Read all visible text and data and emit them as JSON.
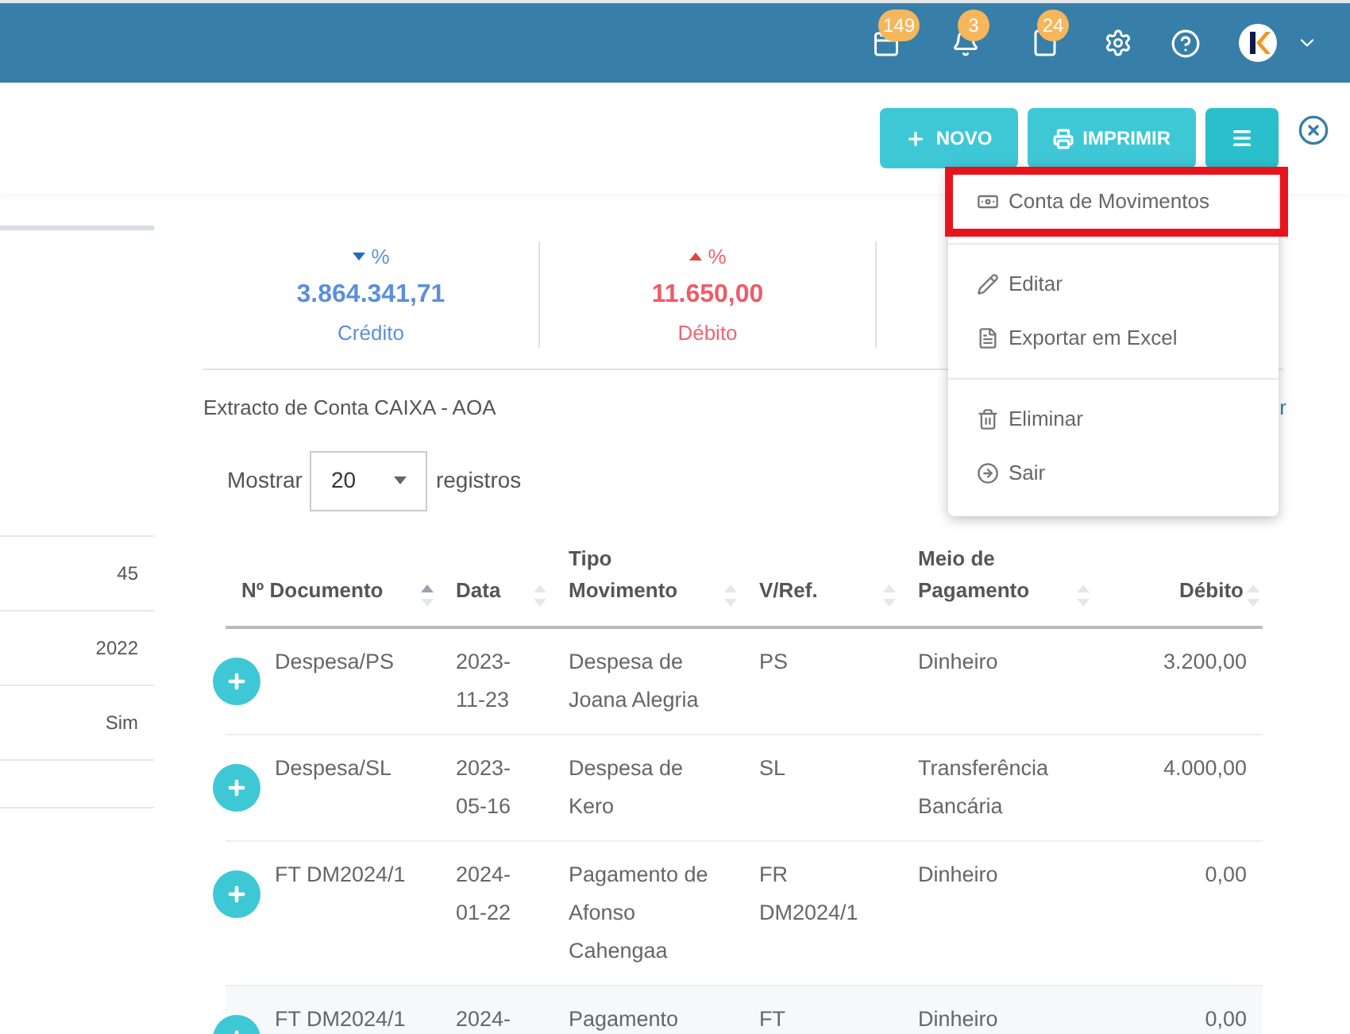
{
  "header": {
    "badges": [
      {
        "kind": "calendar",
        "count": "149"
      },
      {
        "kind": "bell",
        "count": "3"
      },
      {
        "kind": "file",
        "count": "24"
      }
    ]
  },
  "toolbar": {
    "buttons": [
      {
        "kind": "new",
        "label": "NOVO"
      },
      {
        "kind": "print",
        "label": "IMPRIMIR"
      },
      {
        "kind": "menu"
      }
    ]
  },
  "menu": {
    "groups": [
      [
        {
          "kind": "money",
          "label": "Conta de Movimentos",
          "highlighted": true
        }
      ],
      [
        {
          "kind": "pencil",
          "label": "Editar",
          "highlighted": false
        },
        {
          "kind": "file",
          "label": "Exportar em Excel",
          "highlighted": false
        }
      ],
      [
        {
          "kind": "trash",
          "label": "Eliminar",
          "highlighted": false
        },
        {
          "kind": "exit",
          "label": "Sair",
          "highlighted": false
        }
      ]
    ]
  },
  "side_panel": {
    "values": [
      "45",
      "2022",
      "Sim"
    ]
  },
  "stats": [
    {
      "kind": "credit",
      "percent": "%",
      "value": "3.864.341,71",
      "label": "Crédito"
    },
    {
      "kind": "debit",
      "percent": "%",
      "value": "11.650,00",
      "label": "Débito"
    }
  ],
  "statement_title": "Extracto de Conta CAIXA - AOA",
  "side_link": "r",
  "page_size": {
    "before": "Mostrar",
    "value": "20",
    "after": "registros"
  },
  "table": {
    "columns": [
      {
        "label": "Nº Documento",
        "sorted": true
      },
      {
        "label": "Data",
        "sorted": false
      },
      {
        "label": "Tipo Movimento",
        "sorted": false
      },
      {
        "label": "V/Ref.",
        "sorted": false
      },
      {
        "label": "Meio de Pagamento",
        "sorted": false
      },
      {
        "label": "Débito",
        "sorted": false
      }
    ],
    "rows": [
      [
        "Despesa/PS",
        "2023-11-23",
        "Despesa de Joana Alegria",
        "PS",
        "Dinheiro",
        "3.200,00"
      ],
      [
        "Despesa/SL",
        "2023-05-16",
        "Despesa de Kero",
        "SL",
        "Transferência Bancária",
        "4.000,00"
      ],
      [
        "FT DM2024/1",
        "2024-01-22",
        "Pagamento de Afonso Cahengaa",
        "FR DM2024/1",
        "Dinheiro",
        "0,00"
      ],
      [
        "FT DM2024/1",
        "2024-",
        "Pagamento",
        "FT",
        "Dinheiro",
        "0,00"
      ]
    ]
  }
}
